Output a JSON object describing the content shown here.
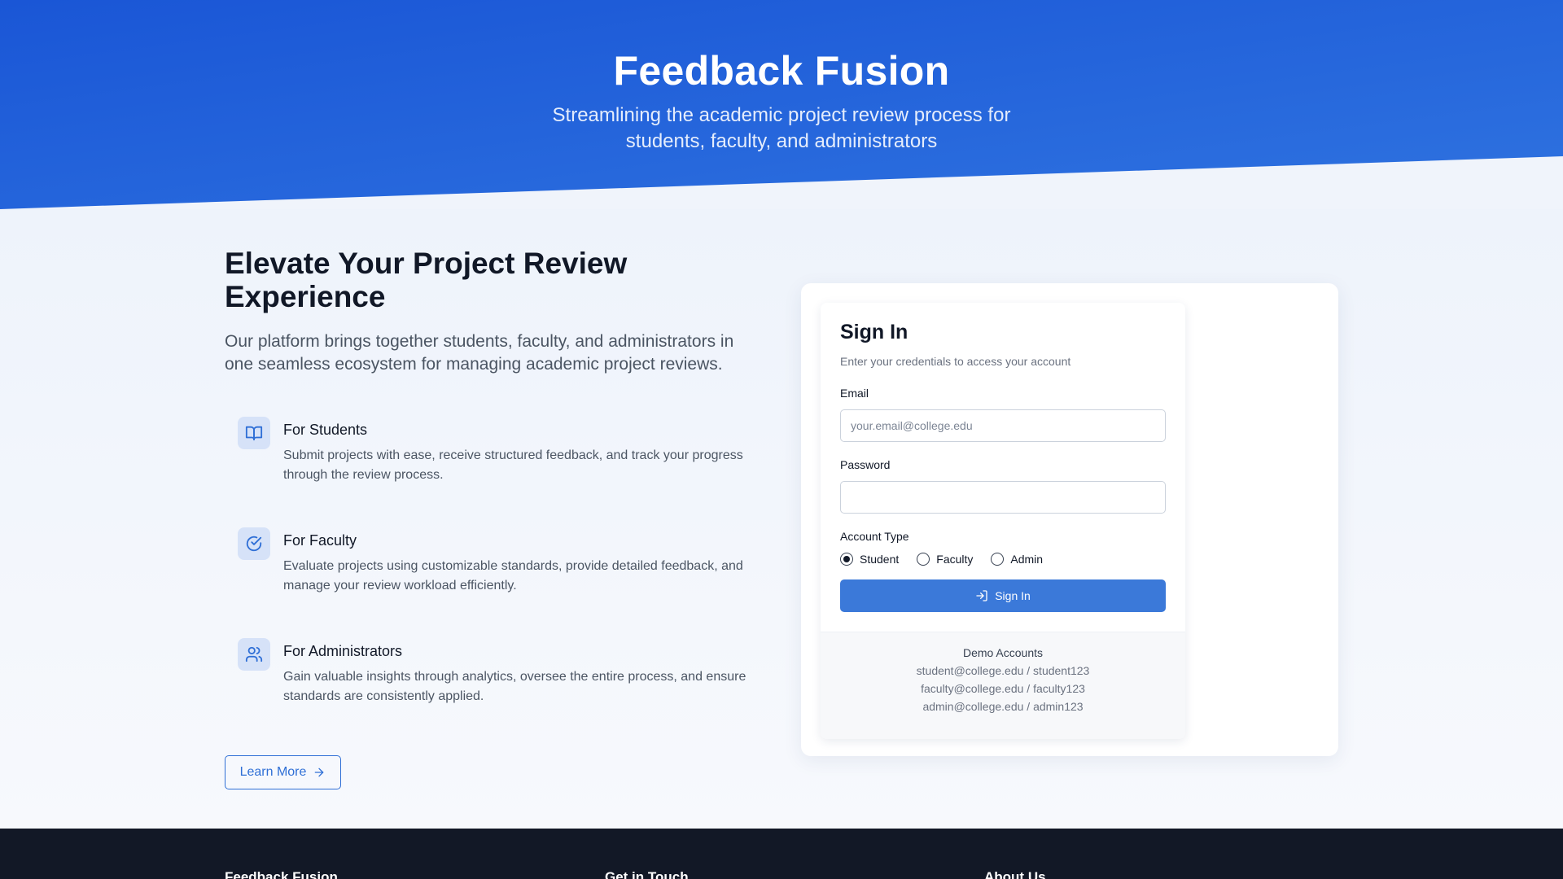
{
  "hero": {
    "title": "Feedback Fusion",
    "subtitle_line1": "Streamlining the academic project review process for",
    "subtitle_line2": "students, faculty, and administrators"
  },
  "intro": {
    "headline_line1": "Elevate Your Project Review",
    "headline_line2": "Experience",
    "lead": "Our platform brings together students, faculty, and administrators in one seamless ecosystem for managing academic project reviews."
  },
  "features": [
    {
      "icon": "book-open-icon",
      "title": "For Students",
      "description": "Submit projects with ease, receive structured feedback, and track your progress through the review process."
    },
    {
      "icon": "check-circle-icon",
      "title": "For Faculty",
      "description": "Evaluate projects using customizable standards, provide detailed feedback, and manage your review workload efficiently."
    },
    {
      "icon": "users-icon",
      "title": "For Administrators",
      "description": "Gain valuable insights through analytics, oversee the entire process, and ensure standards are consistently applied."
    }
  ],
  "learn_more": {
    "label": "Learn More",
    "icon": "arrow-right-icon"
  },
  "signin": {
    "title": "Sign In",
    "subtitle": "Enter your credentials to access your account",
    "email_label": "Email",
    "email_placeholder": "your.email@college.edu",
    "email_value": "",
    "password_label": "Password",
    "password_value": "",
    "account_type_label": "Account Type",
    "account_types": [
      "Student",
      "Faculty",
      "Admin"
    ],
    "selected_account_type": "Student",
    "submit_label": "Sign In",
    "submit_icon": "log-in-icon"
  },
  "demo": {
    "title": "Demo Accounts",
    "accounts": [
      "student@college.edu / student123",
      "faculty@college.edu / faculty123",
      "admin@college.edu / admin123"
    ]
  },
  "footer": {
    "columns": [
      "Feedback Fusion",
      "Get in Touch",
      "About Us"
    ]
  },
  "colors": {
    "hero_gradient_start": "#1a56d6",
    "hero_gradient_end": "#2f73e0",
    "primary": "#3b79d9",
    "link": "#2f6fd6",
    "footer_bg": "#121826",
    "icon_tile": "#d6e2f8"
  }
}
